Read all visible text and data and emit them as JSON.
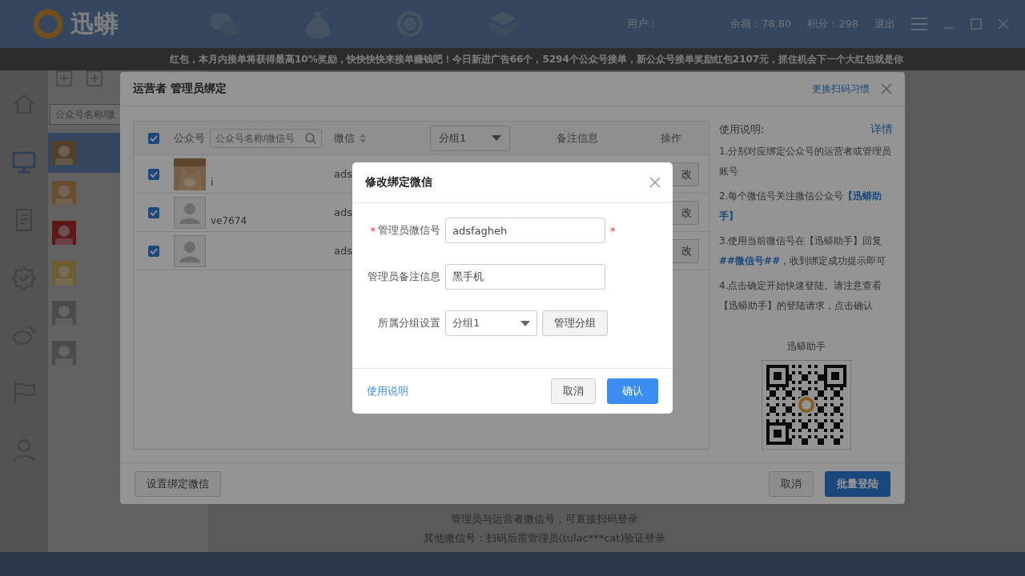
{
  "app": {
    "logo": "迅蟒",
    "user_label": "用户：",
    "balance": "余额：78.80",
    "points": "积分：298",
    "logout": "退出",
    "ticker": "红包，本月内接单将获得最高10%奖励，快快快快来接单赚钱吧！今日新进广告66个，5294个公众号接单，新公众号接单奖励红包2107元，抓住机会下一个大红包就是你",
    "list_search": {
      "placeholder": "公众号名称/微"
    },
    "list_items": [
      {
        "selected": true
      },
      {
        "selected": false
      },
      {
        "selected": false
      },
      {
        "selected": false
      },
      {
        "selected": false
      },
      {
        "selected": false
      }
    ],
    "footer_lines": [
      "管理员与运营者微信号，可直接扫码登录",
      "其他微信号：扫码后需管理员(tulac***cat)验证登录"
    ]
  },
  "bind_dialog": {
    "title": "运营者 管理员绑定",
    "switch_link": "更换扫码习惯",
    "header": {
      "select_all": true,
      "account": "公众号",
      "search_placeholder": "公众号名称/微信号",
      "wechat": "微信",
      "group": "分组1",
      "note": "备注信息",
      "action": "操作"
    },
    "rows": [
      {
        "checked": true,
        "subtitle": "i",
        "wechat": "ads",
        "action": "改"
      },
      {
        "checked": true,
        "kind": "default",
        "subtitle": "ve7674",
        "wechat": "ads",
        "action": "改"
      },
      {
        "checked": true,
        "kind": "default",
        "wechat": "ads",
        "action": "改"
      }
    ],
    "help": {
      "title": "使用说明:",
      "detail_link": "详情",
      "steps": [
        "1.分别对应绑定公众号的运营者或管理员账号",
        "2.每个微信号关注微信公众号**【迅蟒助手】**",
        "3.使用当前微信号在【迅蟒助手】回复**##微信号##**，收到绑定成功提示即可",
        "4.点击确定开始快速登陆。请注意查看【迅蟒助手】的登陆请求，点击确认"
      ],
      "qr_label": "迅蟒助手"
    },
    "left_button": "设置绑定微信",
    "cancel": "取消",
    "confirm": "批量登陆"
  },
  "edit_dialog": {
    "title": "修改绑定微信",
    "required_mark": "*",
    "fields": [
      {
        "kind": "text",
        "label": "管理员微信号",
        "value": "adsfagheh",
        "required": true
      },
      {
        "kind": "text",
        "label": "管理员备注信息",
        "value": "黑手机",
        "required": false
      },
      {
        "kind": "select",
        "label": "所属分组设置",
        "value": "分组1",
        "required": false,
        "extra_button": "管理分组"
      }
    ],
    "help_link": "使用说明",
    "cancel": "取消",
    "confirm": "确认"
  }
}
